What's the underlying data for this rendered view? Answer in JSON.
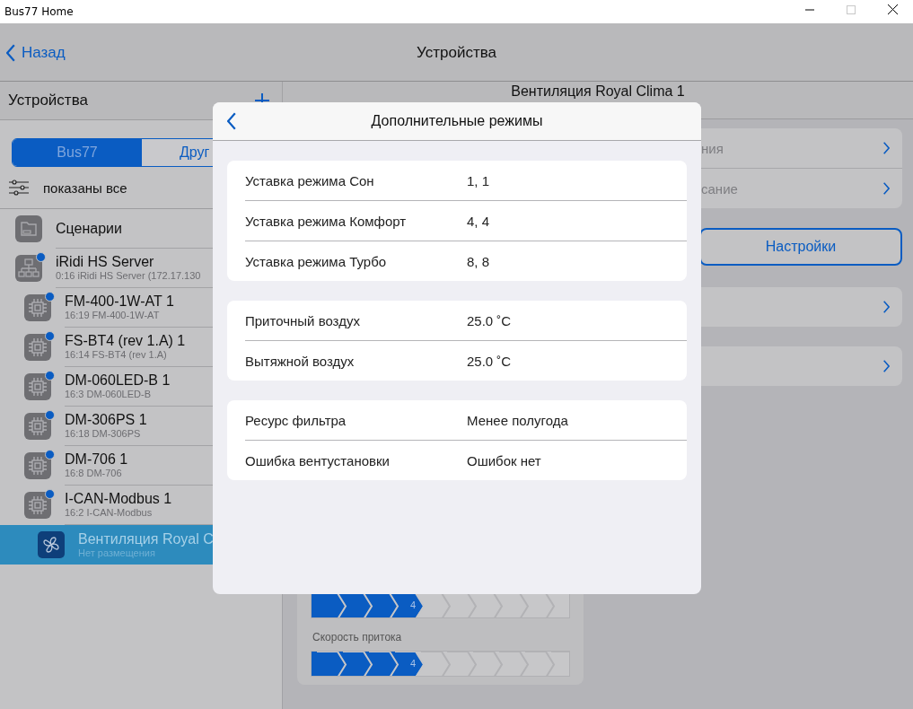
{
  "window": {
    "title": "Bus77 Home"
  },
  "nav": {
    "back": "Назад",
    "title": "Устройства"
  },
  "sidebar": {
    "title": "Устройства",
    "segments": [
      {
        "label": "Bus77",
        "selected": true
      },
      {
        "label": "Друг",
        "selected": false
      }
    ],
    "filter": "показаны все",
    "items": [
      {
        "kind": "folder",
        "title": "Сценарии",
        "online": false,
        "selected": false
      },
      {
        "kind": "server",
        "title": "iRidi HS Server",
        "subtitle": "0:16 iRidi HS Server (172.17.130",
        "online": true,
        "selected": false,
        "children": [
          {
            "kind": "chip",
            "title": "FM-400-1W-AT 1",
            "subtitle": "16:19 FM-400-1W-AT",
            "online": true,
            "selected": false
          },
          {
            "kind": "chip",
            "title": "FS-BT4 (rev 1.A) 1",
            "subtitle": "16:14 FS-BT4 (rev 1.A)",
            "online": true,
            "selected": false
          },
          {
            "kind": "chip",
            "title": "DM-060LED-B 1",
            "subtitle": "16:3 DM-060LED-B",
            "online": true,
            "selected": false
          },
          {
            "kind": "chip",
            "title": "DM-306PS 1",
            "subtitle": "16:18 DM-306PS",
            "online": true,
            "selected": false
          },
          {
            "kind": "chip",
            "title": "DM-706 1",
            "subtitle": "16:8 DM-706",
            "online": true,
            "selected": false
          },
          {
            "kind": "chip",
            "title": "I-CAN-Modbus 1",
            "subtitle": "16:2 I-CAN-Modbus",
            "online": true,
            "selected": false,
            "children": [
              {
                "kind": "fan",
                "title": "Вентиляция Royal C",
                "subtitle": "Нет размещения",
                "online": false,
                "selected": true
              }
            ]
          }
        ]
      }
    ]
  },
  "detail": {
    "title": "Вентиляция Royal Clima 1",
    "rows": [
      {
        "label": "ния"
      },
      {
        "label": "сание"
      }
    ],
    "settings_button": "Настройки",
    "speed_bars": [
      {
        "level": 0.4,
        "reading": "4"
      },
      {
        "label": "Скорость притока",
        "level": 0.4,
        "reading": "4"
      }
    ]
  },
  "dialog": {
    "title": "Дополнительные режимы",
    "groups": [
      [
        {
          "label": "Уставка режима Сон",
          "value": "1, 1"
        },
        {
          "label": "Уставка режима Комфорт",
          "value": "4, 4"
        },
        {
          "label": "Уставка режима Турбо",
          "value": "8, 8"
        }
      ],
      [
        {
          "label": "Приточный воздух",
          "value": "25.0 ˚C"
        },
        {
          "label": "Вытяжной воздух",
          "value": "25.0 ˚C"
        }
      ],
      [
        {
          "label": "Ресурс фильтра",
          "value": "Менее полугода"
        },
        {
          "label": "Ошибка вентустановки",
          "value": "Ошибок нет"
        }
      ]
    ]
  }
}
